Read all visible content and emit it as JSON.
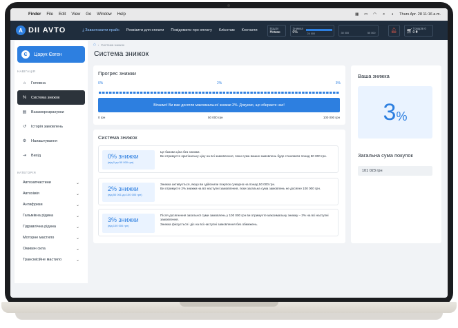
{
  "macbar": {
    "app": "Finder",
    "menus": [
      "File",
      "Edit",
      "View",
      "Go",
      "Window",
      "Help"
    ],
    "clock": "Thurs Apr. 28 11:16 a.m."
  },
  "header": {
    "logo_text": "DII AVTO",
    "nav": [
      "Завантажити прайс",
      "Реквізити для оплати",
      "Повідомити про оплату",
      "Клієнтам",
      "Контакти"
    ],
    "box1": {
      "label": "Відділ",
      "value": "Немає"
    },
    "box2": {
      "label": "Знижка",
      "value": "0%"
    },
    "box3": {
      "left": "24 000",
      "mid": "30 000",
      "right": "50 000"
    },
    "cart": {
      "label": "Товарів 0",
      "value": "0 ₴"
    }
  },
  "sidebar": {
    "user": "Царук Євген",
    "user_initial": "Є",
    "nav_label": "НАВІГАЦІЯ",
    "nav_items": [
      "Головна",
      "Система знижок",
      "Взаєморозрахунки",
      "Історія замовлень",
      "Налаштування",
      "Вихід"
    ],
    "cat_label": "КАТЕГОРІЯ",
    "categories": [
      "Автозапчастини",
      "Автохімія",
      "Антифризи",
      "Гальмівна рідина",
      "Гідравлічна рідина",
      "Моторне мастило",
      "Омивач скла",
      "Трансмісійне мастило"
    ]
  },
  "breadcrumb": "Система знижок",
  "page_title": "Система знижок",
  "progress": {
    "title": "Прогрес знижки",
    "marks": [
      "0%",
      "2%",
      "3%"
    ],
    "progress_fraction": 1.0,
    "bar_text": "Вітаємо! Ви вже досягли максимальної знижки 3%. Дякуємо, що обираєте нас!",
    "foot": [
      "0 грн",
      "50 000 грн",
      "100 000 грн"
    ]
  },
  "discounts": {
    "title": "Система знижок",
    "items": [
      {
        "title": "0% знижки",
        "range": "(від 0 до 50 000 грн)",
        "lines": [
          "Це базова ціна без знижки.",
          "Ви отримуєте оригінальну ціну на всі замовлення, поки сума ваших замовлень буде становити понад 50 000 грн."
        ]
      },
      {
        "title": "2% знижки",
        "range": "(від 50 001 до 100 000 грн)",
        "lines": [
          "Знижка активується, якщо ви здійснили покупок сумарно на понад 50 000 грн.",
          "Ви отримуєте 2% знижки на всі наступні замовлення, поки загальна сума замовлень не досягне 100 000 грн."
        ]
      },
      {
        "title": "3% знижки",
        "range": "(від 100 000 грн)",
        "lines": [
          "Після досягнення загальної суми замовлень у 100 000 грн ви отримуєте максимальну знижку – 3% на всі наступні замовлення.",
          "Знижка фіксується і діє на всі наступні замовлення без обмежень."
        ]
      }
    ]
  },
  "your_discount": {
    "title": "Ваша знижка",
    "value": "3",
    "unit": "%"
  },
  "total": {
    "title": "Загальна сума покупок",
    "value": "101 023 грн"
  },
  "colors": {
    "accent": "#2d7fe0",
    "header": "#1f2d3d",
    "active_nav": "#2c333b"
  }
}
